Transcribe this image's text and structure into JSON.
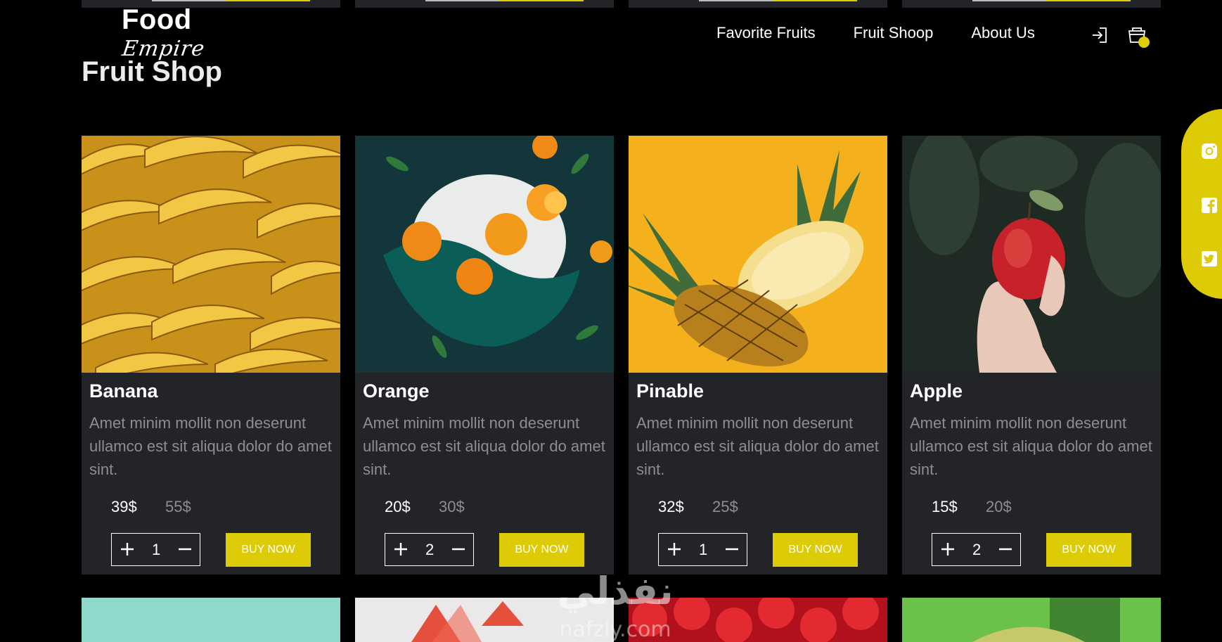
{
  "logo": {
    "line1": "Food",
    "line2": "Empire",
    "line3": "Fruit Shop"
  },
  "nav": {
    "items": [
      {
        "label": "Favorite Fruits"
      },
      {
        "label": "Fruit Shoop"
      },
      {
        "label": "About Us"
      }
    ],
    "icons": [
      "login-icon",
      "cart-icon"
    ]
  },
  "social": {
    "icons": [
      "instagram-icon",
      "facebook-icon",
      "twitter-icon"
    ]
  },
  "products": [
    {
      "name": "Banana",
      "description": "Amet minim mollit non deserunt ullamco est sit aliqua dolor do amet sint.",
      "price_new": "39$",
      "price_old": "55$",
      "quantity": "1",
      "buy_label": "BUY NOW"
    },
    {
      "name": "Orange",
      "description": "Amet minim mollit non deserunt ullamco est sit aliqua dolor do amet sint.",
      "price_new": "20$",
      "price_old": "30$",
      "quantity": "2",
      "buy_label": "BUY NOW"
    },
    {
      "name": "Pinable",
      "description": "Amet minim mollit non deserunt ullamco est sit aliqua dolor do amet sint.",
      "price_new": "32$",
      "price_old": "25$",
      "quantity": "1",
      "buy_label": "BUY NOW"
    },
    {
      "name": "Apple",
      "description": "Amet minim mollit non deserunt ullamco est sit aliqua dolor do amet sint.",
      "price_new": "15$",
      "price_old": "20$",
      "quantity": "2",
      "buy_label": "BUY NOW"
    }
  ],
  "watermark": {
    "arabic": "نفذلي",
    "latin": "nafzly.com"
  },
  "colors": {
    "accent": "#dccb06",
    "background": "#000000",
    "card": "#222428",
    "muted_text": "#8d8e90"
  }
}
